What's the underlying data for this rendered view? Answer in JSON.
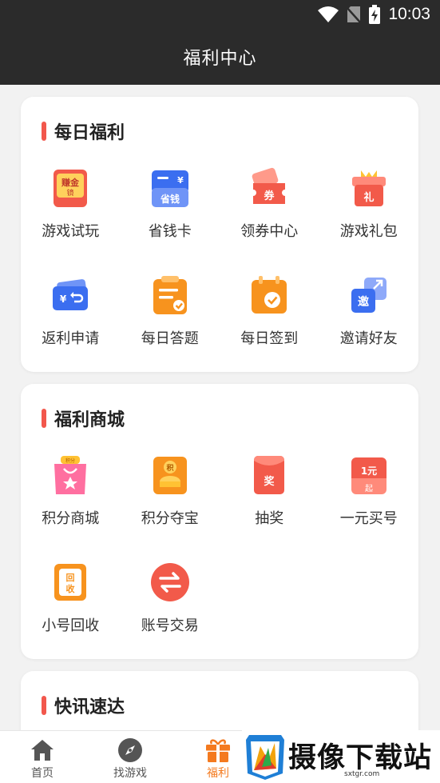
{
  "status": {
    "time": "10:03"
  },
  "header": {
    "title": "福利中心"
  },
  "sections": [
    {
      "title": "每日福利",
      "items": [
        {
          "label": "游戏试玩",
          "icon": "earn-gold-icon"
        },
        {
          "label": "省钱卡",
          "icon": "save-card-icon"
        },
        {
          "label": "领券中心",
          "icon": "coupon-icon"
        },
        {
          "label": "游戏礼包",
          "icon": "gift-pack-icon"
        },
        {
          "label": "返利申请",
          "icon": "rebate-wallet-icon"
        },
        {
          "label": "每日答题",
          "icon": "quiz-clipboard-icon"
        },
        {
          "label": "每日签到",
          "icon": "checkin-calendar-icon"
        },
        {
          "label": "邀请好友",
          "icon": "invite-icon"
        }
      ]
    },
    {
      "title": "福利商城",
      "items": [
        {
          "label": "积分商城",
          "icon": "points-mall-bag-icon"
        },
        {
          "label": "积分夺宝",
          "icon": "treasure-icon"
        },
        {
          "label": "抽奖",
          "icon": "lottery-envelope-icon"
        },
        {
          "label": "一元买号",
          "icon": "one-yuan-icon"
        },
        {
          "label": "小号回收",
          "icon": "recycle-icon"
        },
        {
          "label": "账号交易",
          "icon": "exchange-arrows-icon"
        }
      ]
    },
    {
      "title": "快讯速达"
    }
  ],
  "icon_text": {
    "earn": "赚金",
    "earn_sub": "镜",
    "save": "省钱",
    "yen": "¥",
    "coupon": "券",
    "gift": "礼",
    "invite": "邀",
    "points": "积分",
    "points_short": "积",
    "prize": "奖",
    "one_yuan": "1元",
    "qi": "起",
    "hui": "回",
    "shou": "收"
  },
  "tabs": [
    {
      "label": "首页",
      "icon": "home-icon",
      "active": false
    },
    {
      "label": "找游戏",
      "icon": "compass-icon",
      "active": false
    },
    {
      "label": "福利",
      "icon": "gift-icon",
      "active": true
    }
  ],
  "watermark": {
    "text": "摄像下载站",
    "url": "sxtgr.com"
  },
  "colors": {
    "accent": "#f47a1f",
    "title_bar": "#f2574c",
    "header_bg": "#2b2b2b"
  }
}
